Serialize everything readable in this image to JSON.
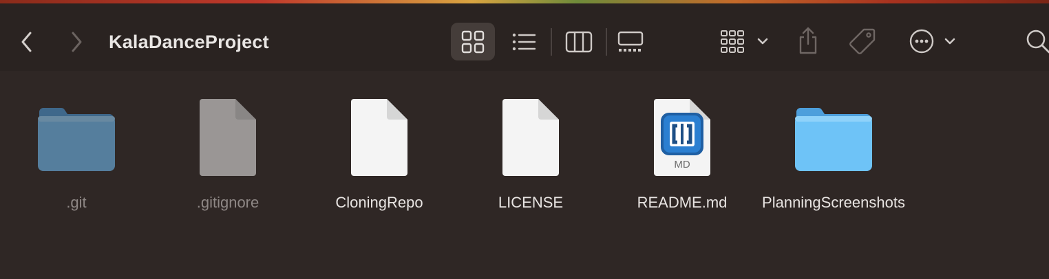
{
  "window": {
    "title": "KalaDanceProject"
  },
  "toolbar": {
    "back": {
      "icon": "chevron-left-icon"
    },
    "forward": {
      "icon": "chevron-right-icon"
    },
    "views": [
      {
        "name": "icon-view",
        "icon": "grid-icon",
        "selected": true
      },
      {
        "name": "list-view",
        "icon": "list-icon",
        "selected": false
      },
      {
        "name": "column-view",
        "icon": "columns-icon",
        "selected": false
      },
      {
        "name": "gallery-view",
        "icon": "gallery-icon",
        "selected": false
      }
    ],
    "group_button": {
      "icon": "group-grid-icon"
    },
    "share_button": {
      "icon": "share-icon"
    },
    "tag_button": {
      "icon": "tag-icon"
    },
    "more_button": {
      "icon": "ellipsis-circle-icon"
    },
    "search_button": {
      "icon": "search-icon"
    }
  },
  "files": [
    {
      "name": ".git",
      "kind": "folder",
      "dimmed": true
    },
    {
      "name": ".gitignore",
      "kind": "document",
      "dimmed": true
    },
    {
      "name": "CloningRepo",
      "kind": "document",
      "dimmed": false
    },
    {
      "name": "LICENSE",
      "kind": "document",
      "dimmed": false
    },
    {
      "name": "README.md",
      "kind": "markdown-document",
      "badge": "MD",
      "dimmed": false
    },
    {
      "name": "PlanningScreenshots",
      "kind": "folder",
      "dimmed": false
    }
  ],
  "colors": {
    "folder": "#6ec3f7",
    "folder_dim": "#4f7fa3",
    "accent_brackets": "#2b7fd1"
  }
}
